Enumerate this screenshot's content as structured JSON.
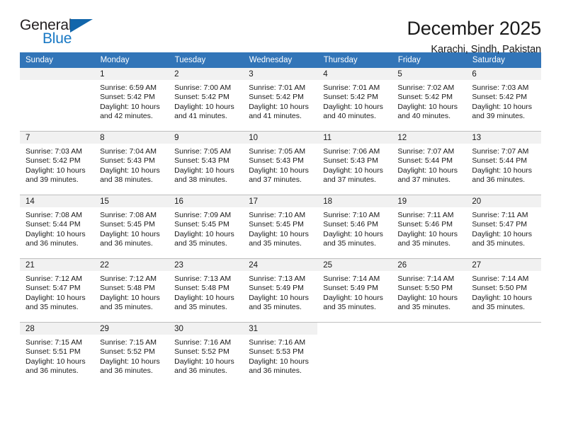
{
  "logo": {
    "word_general": "General",
    "word_blue": "Blue",
    "triangle_color": "#1266ab",
    "blue_color": "#1878c4"
  },
  "header": {
    "title": "December 2025",
    "subtitle": "Karachi, Sindh, Pakistan"
  },
  "calendar": {
    "header_color": "#3275b8",
    "daynum_band_color": "#f1f1f1",
    "weekdays": [
      "Sunday",
      "Monday",
      "Tuesday",
      "Wednesday",
      "Thursday",
      "Friday",
      "Saturday"
    ],
    "labels": {
      "sunrise": "Sunrise:",
      "sunset": "Sunset:",
      "daylight": "Daylight:"
    },
    "weeks": [
      [
        {
          "day": "",
          "empty": true
        },
        {
          "day": "1",
          "sunrise": "Sunrise: 6:59 AM",
          "sunset": "Sunset: 5:42 PM",
          "daylight": "Daylight: 10 hours and 42 minutes."
        },
        {
          "day": "2",
          "sunrise": "Sunrise: 7:00 AM",
          "sunset": "Sunset: 5:42 PM",
          "daylight": "Daylight: 10 hours and 41 minutes."
        },
        {
          "day": "3",
          "sunrise": "Sunrise: 7:01 AM",
          "sunset": "Sunset: 5:42 PM",
          "daylight": "Daylight: 10 hours and 41 minutes."
        },
        {
          "day": "4",
          "sunrise": "Sunrise: 7:01 AM",
          "sunset": "Sunset: 5:42 PM",
          "daylight": "Daylight: 10 hours and 40 minutes."
        },
        {
          "day": "5",
          "sunrise": "Sunrise: 7:02 AM",
          "sunset": "Sunset: 5:42 PM",
          "daylight": "Daylight: 10 hours and 40 minutes."
        },
        {
          "day": "6",
          "sunrise": "Sunrise: 7:03 AM",
          "sunset": "Sunset: 5:42 PM",
          "daylight": "Daylight: 10 hours and 39 minutes."
        }
      ],
      [
        {
          "day": "7",
          "sunrise": "Sunrise: 7:03 AM",
          "sunset": "Sunset: 5:42 PM",
          "daylight": "Daylight: 10 hours and 39 minutes."
        },
        {
          "day": "8",
          "sunrise": "Sunrise: 7:04 AM",
          "sunset": "Sunset: 5:43 PM",
          "daylight": "Daylight: 10 hours and 38 minutes."
        },
        {
          "day": "9",
          "sunrise": "Sunrise: 7:05 AM",
          "sunset": "Sunset: 5:43 PM",
          "daylight": "Daylight: 10 hours and 38 minutes."
        },
        {
          "day": "10",
          "sunrise": "Sunrise: 7:05 AM",
          "sunset": "Sunset: 5:43 PM",
          "daylight": "Daylight: 10 hours and 37 minutes."
        },
        {
          "day": "11",
          "sunrise": "Sunrise: 7:06 AM",
          "sunset": "Sunset: 5:43 PM",
          "daylight": "Daylight: 10 hours and 37 minutes."
        },
        {
          "day": "12",
          "sunrise": "Sunrise: 7:07 AM",
          "sunset": "Sunset: 5:44 PM",
          "daylight": "Daylight: 10 hours and 37 minutes."
        },
        {
          "day": "13",
          "sunrise": "Sunrise: 7:07 AM",
          "sunset": "Sunset: 5:44 PM",
          "daylight": "Daylight: 10 hours and 36 minutes."
        }
      ],
      [
        {
          "day": "14",
          "sunrise": "Sunrise: 7:08 AM",
          "sunset": "Sunset: 5:44 PM",
          "daylight": "Daylight: 10 hours and 36 minutes."
        },
        {
          "day": "15",
          "sunrise": "Sunrise: 7:08 AM",
          "sunset": "Sunset: 5:45 PM",
          "daylight": "Daylight: 10 hours and 36 minutes."
        },
        {
          "day": "16",
          "sunrise": "Sunrise: 7:09 AM",
          "sunset": "Sunset: 5:45 PM",
          "daylight": "Daylight: 10 hours and 35 minutes."
        },
        {
          "day": "17",
          "sunrise": "Sunrise: 7:10 AM",
          "sunset": "Sunset: 5:45 PM",
          "daylight": "Daylight: 10 hours and 35 minutes."
        },
        {
          "day": "18",
          "sunrise": "Sunrise: 7:10 AM",
          "sunset": "Sunset: 5:46 PM",
          "daylight": "Daylight: 10 hours and 35 minutes."
        },
        {
          "day": "19",
          "sunrise": "Sunrise: 7:11 AM",
          "sunset": "Sunset: 5:46 PM",
          "daylight": "Daylight: 10 hours and 35 minutes."
        },
        {
          "day": "20",
          "sunrise": "Sunrise: 7:11 AM",
          "sunset": "Sunset: 5:47 PM",
          "daylight": "Daylight: 10 hours and 35 minutes."
        }
      ],
      [
        {
          "day": "21",
          "sunrise": "Sunrise: 7:12 AM",
          "sunset": "Sunset: 5:47 PM",
          "daylight": "Daylight: 10 hours and 35 minutes."
        },
        {
          "day": "22",
          "sunrise": "Sunrise: 7:12 AM",
          "sunset": "Sunset: 5:48 PM",
          "daylight": "Daylight: 10 hours and 35 minutes."
        },
        {
          "day": "23",
          "sunrise": "Sunrise: 7:13 AM",
          "sunset": "Sunset: 5:48 PM",
          "daylight": "Daylight: 10 hours and 35 minutes."
        },
        {
          "day": "24",
          "sunrise": "Sunrise: 7:13 AM",
          "sunset": "Sunset: 5:49 PM",
          "daylight": "Daylight: 10 hours and 35 minutes."
        },
        {
          "day": "25",
          "sunrise": "Sunrise: 7:14 AM",
          "sunset": "Sunset: 5:49 PM",
          "daylight": "Daylight: 10 hours and 35 minutes."
        },
        {
          "day": "26",
          "sunrise": "Sunrise: 7:14 AM",
          "sunset": "Sunset: 5:50 PM",
          "daylight": "Daylight: 10 hours and 35 minutes."
        },
        {
          "day": "27",
          "sunrise": "Sunrise: 7:14 AM",
          "sunset": "Sunset: 5:50 PM",
          "daylight": "Daylight: 10 hours and 35 minutes."
        }
      ],
      [
        {
          "day": "28",
          "sunrise": "Sunrise: 7:15 AM",
          "sunset": "Sunset: 5:51 PM",
          "daylight": "Daylight: 10 hours and 36 minutes."
        },
        {
          "day": "29",
          "sunrise": "Sunrise: 7:15 AM",
          "sunset": "Sunset: 5:52 PM",
          "daylight": "Daylight: 10 hours and 36 minutes."
        },
        {
          "day": "30",
          "sunrise": "Sunrise: 7:16 AM",
          "sunset": "Sunset: 5:52 PM",
          "daylight": "Daylight: 10 hours and 36 minutes."
        },
        {
          "day": "31",
          "sunrise": "Sunrise: 7:16 AM",
          "sunset": "Sunset: 5:53 PM",
          "daylight": "Daylight: 10 hours and 36 minutes."
        },
        {
          "day": "",
          "blank": true
        },
        {
          "day": "",
          "blank": true
        },
        {
          "day": "",
          "blank": true
        }
      ]
    ]
  }
}
